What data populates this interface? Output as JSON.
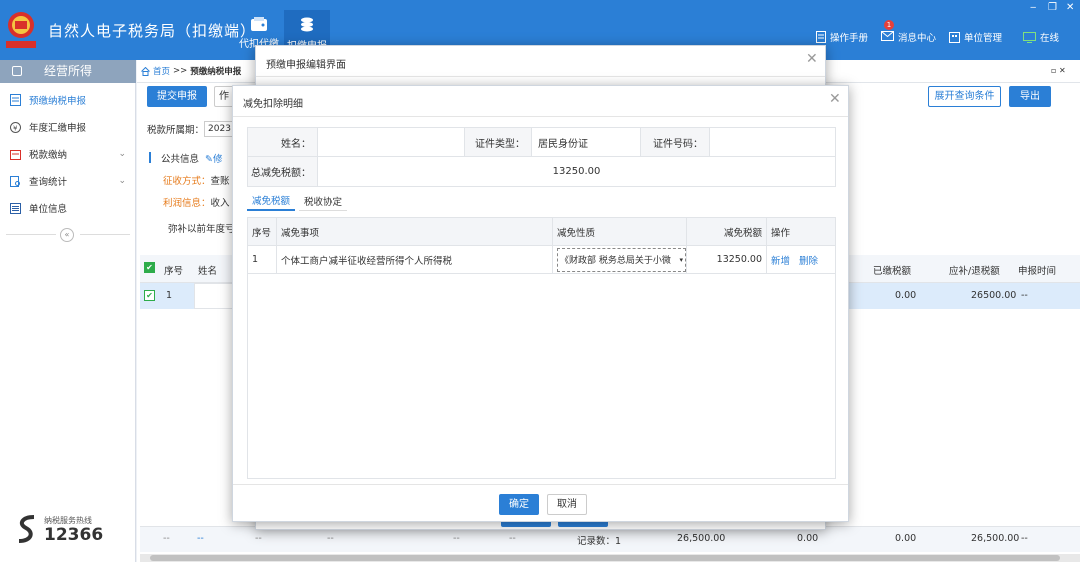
{
  "app": {
    "title": "自然人电子税务局（扣缴端）",
    "logo_text": "中国税务"
  },
  "topnav": [
    {
      "label": "代扣代缴"
    },
    {
      "label": "扣缴申报"
    }
  ],
  "topright": {
    "manual": "操作手册",
    "messages": "消息中心",
    "message_badge": "1",
    "unit": "单位管理",
    "online": "在线"
  },
  "window_controls": {
    "minimize": "‒",
    "restore": "❐",
    "close": "✕"
  },
  "sidebar": {
    "title": "经营所得",
    "items": [
      {
        "label": "预缴纳税申报",
        "icon": "report-icon",
        "active": true
      },
      {
        "label": "年度汇缴申报",
        "icon": "yen-icon"
      },
      {
        "label": "税款缴纳",
        "icon": "wallet-icon",
        "chevron": "⌄"
      },
      {
        "label": "查询统计",
        "icon": "query-icon",
        "chevron": "⌄"
      },
      {
        "label": "单位信息",
        "icon": "list-icon"
      }
    ],
    "collapse": "«",
    "hotline_label": "纳税服务热线",
    "hotline_number": "12366"
  },
  "breadcrumb": {
    "home": "首页",
    "sep": ">>",
    "current": "预缴纳税申报"
  },
  "main": {
    "submit_btn": "提交申报",
    "second_btn": "作",
    "expand_btn": "展开查询条件",
    "export_btn": "导出",
    "period_label": "税款所属期：",
    "period_value": "2023",
    "public_info": "公共信息",
    "edit_icon_text": "修",
    "collect_method_label": "征收方式：",
    "collect_method_value": "查账",
    "profit_label": "利润信息：",
    "profit_value": "收入",
    "makeup_text": "弥补以前年度亏",
    "panel_close": "▫ ✕",
    "table_headers": [
      "序号",
      "姓名",
      "已缴税额",
      "应补/退税额",
      "申报时间"
    ],
    "row": {
      "seq": "1",
      "paid": "0.00",
      "due": "26500.00",
      "time": "--"
    },
    "footer_cells": [
      "--",
      "--",
      "--",
      "--",
      "--",
      "--",
      "记录数：1",
      "26,500.00",
      "0.00",
      "0.00",
      "26,500.00",
      "--"
    ]
  },
  "back_dialog": {
    "title": "预缴申报编辑界面",
    "close": "✕"
  },
  "dialog": {
    "title": "减免扣除明细",
    "close": "✕",
    "name_label": "姓名：",
    "name_value": "",
    "id_type_label": "证件类型：",
    "id_type_value": "居民身份证",
    "id_no_label": "证件号码：",
    "id_no_value": "",
    "total_label": "总减免税额：",
    "total_value": "13250.00",
    "tabs": [
      {
        "label": "减免税额",
        "active": true
      },
      {
        "label": "税收协定"
      }
    ],
    "headers": [
      "序号",
      "减免事项",
      "减免性质",
      "减免税额",
      "操作"
    ],
    "rows": [
      {
        "seq": "1",
        "item": "个体工商户减半征收经营所得个人所得税",
        "nature": "《财政部 税务总局关于小微",
        "amount": "13250.00",
        "add": "新增",
        "del": "删除"
      }
    ],
    "ok": "确定",
    "cancel": "取消"
  }
}
